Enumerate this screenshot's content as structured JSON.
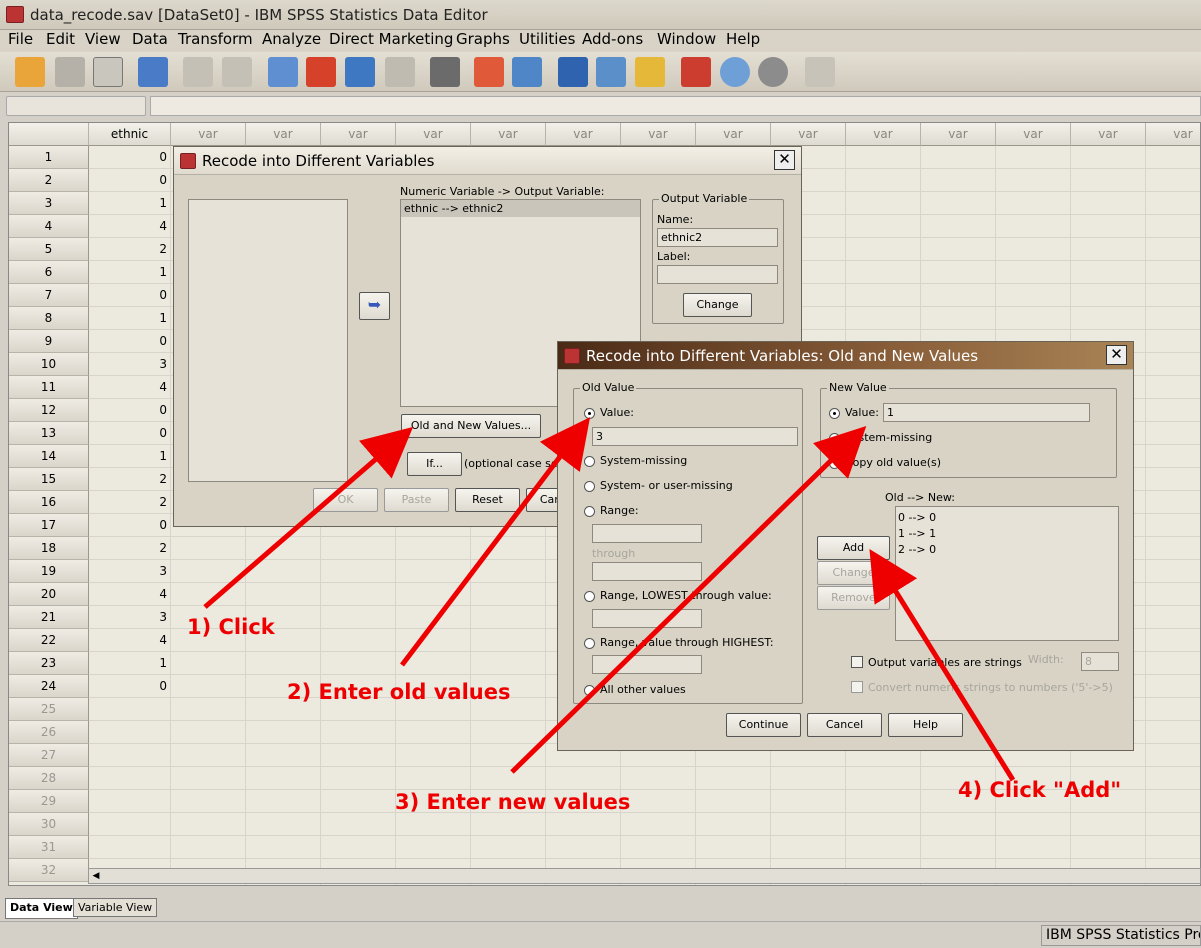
{
  "window_title": "data_recode.sav [DataSet0] - IBM SPSS Statistics Data Editor",
  "menu": [
    "File",
    "Edit",
    "View",
    "Data",
    "Transform",
    "Analyze",
    "Direct Marketing",
    "Graphs",
    "Utilities",
    "Add-ons",
    "Window",
    "Help"
  ],
  "toolbar_icons": [
    "open-icon",
    "save-icon",
    "print-icon",
    "dialog-recall-icon",
    "undo-icon",
    "redo-icon",
    "goto-case-icon",
    "goto-variable-icon",
    "variables-icon",
    "run-icon",
    "find-icon",
    "insert-case-icon",
    "insert-variable-icon",
    "split-file-icon",
    "weight-cases-icon",
    "select-cases-icon",
    "value-labels-icon",
    "use-variable-sets-icon",
    "show-all-variables-icon",
    "spell-check-icon"
  ],
  "grid": {
    "columns": [
      "ethnic",
      "var",
      "var",
      "var",
      "var",
      "var",
      "var",
      "var",
      "var",
      "var",
      "var",
      "var",
      "var",
      "var",
      "var"
    ],
    "rows": [
      "1",
      "2",
      "3",
      "4",
      "5",
      "6",
      "7",
      "8",
      "9",
      "10",
      "11",
      "12",
      "13",
      "14",
      "15",
      "16",
      "17",
      "18",
      "19",
      "20",
      "21",
      "22",
      "23",
      "24",
      "25",
      "26",
      "27",
      "28",
      "29",
      "30",
      "31",
      "32"
    ],
    "ethnic_values": [
      "0",
      "0",
      "1",
      "4",
      "2",
      "1",
      "0",
      "1",
      "0",
      "3",
      "4",
      "0",
      "0",
      "1",
      "2",
      "2",
      "0",
      "2",
      "3",
      "4",
      "3",
      "4",
      "1",
      "0"
    ]
  },
  "tabs": {
    "data_view": "Data View",
    "variable_view": "Variable View"
  },
  "status": "IBM SPSS Statistics Processor is ready",
  "dialog1": {
    "title": "Recode into Different Variables",
    "list_header": "Numeric Variable -> Output Variable:",
    "list_item": "ethnic --> ethnic2",
    "output_group": "Output Variable",
    "name_label": "Name:",
    "name_value": "ethnic2",
    "label_label": "Label:",
    "label_value": "",
    "change": "Change",
    "old_new": "Old and New Values...",
    "if_btn": "If...",
    "if_text": "(optional case selection condition)",
    "ok": "OK",
    "paste": "Paste",
    "reset": "Reset",
    "cancel": "Cancel"
  },
  "dialog2": {
    "title": "Recode into Different Variables: Old and New Values",
    "old_value_group": "Old Value",
    "value_label": "Value:",
    "old_value": "3",
    "system_missing": "System-missing",
    "sys_user_missing": "System- or user-missing",
    "range": "Range:",
    "through": "through",
    "range_lowest": "Range, LOWEST through value:",
    "range_highest": "Range, value through HIGHEST:",
    "all_other": "All other values",
    "new_value_group": "New Value",
    "new_value_label": "Value:",
    "new_value": "1",
    "new_system_missing": "System-missing",
    "copy_old": "Copy old value(s)",
    "old_new_header": "Old --> New:",
    "old_new_items": [
      "0 --> 0",
      "1 --> 1",
      "2 --> 0"
    ],
    "add": "Add",
    "change": "Change",
    "remove": "Remove",
    "output_strings": "Output variables are strings",
    "width_label": "Width:",
    "width_value": "8",
    "convert_numeric": "Convert numeric strings to numbers ('5'->5)",
    "continue": "Continue",
    "cancel": "Cancel",
    "help": "Help"
  },
  "annotations": {
    "step1": "1) Click",
    "step2": "2) Enter old values",
    "step3": "3) Enter new values",
    "step4": "4) Click \"Add\""
  },
  "colors": {
    "annotation": "#ee0000",
    "titlebar_dialog": "#6b4526"
  }
}
